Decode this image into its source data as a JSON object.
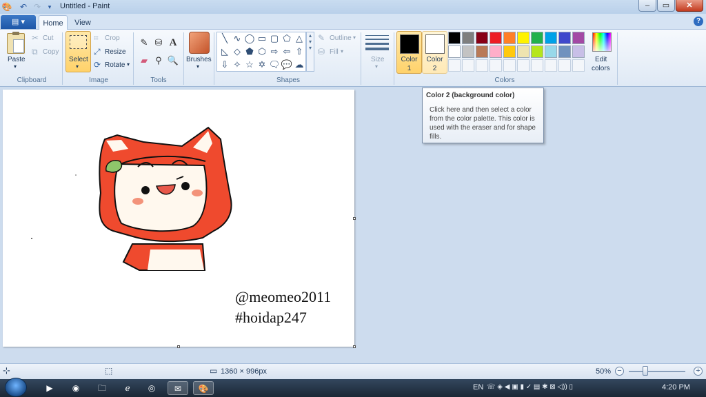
{
  "window": {
    "title": "Untitled - Paint",
    "minimize": "–",
    "maximize": "▭",
    "close": "✕"
  },
  "tabs": {
    "app_menu": "▤ ▾",
    "home": "Home",
    "view": "View",
    "help": "?"
  },
  "clipboard": {
    "paste": "Paste",
    "cut": "Cut",
    "copy": "Copy",
    "group": "Clipboard"
  },
  "image": {
    "select": "Select",
    "crop": "Crop",
    "resize": "Resize",
    "rotate": "Rotate",
    "group": "Image"
  },
  "tools": {
    "group": "Tools",
    "text_tool": "A"
  },
  "brushes": {
    "label": "Brushes"
  },
  "shapes": {
    "outline": "Outline",
    "fill": "Fill",
    "group": "Shapes"
  },
  "size": {
    "label": "Size"
  },
  "colors": {
    "color1_label": "Color",
    "color1_num": "1",
    "color2_label": "Color",
    "color2_num": "2",
    "color1": "#000000",
    "color2": "#ffffff",
    "edit_label": "Edit",
    "edit_label2": "colors",
    "group": "Colors",
    "palette_row1": [
      "#000000",
      "#7f7f7f",
      "#880015",
      "#ed1c24",
      "#ff7f27",
      "#fff200",
      "#22b14c",
      "#00a2e8",
      "#3f48cc",
      "#a349a4"
    ],
    "palette_row2": [
      "#ffffff",
      "#c3c3c3",
      "#b97a57",
      "#ffaec9",
      "#ffc90e",
      "#efe4b0",
      "#b5e61d",
      "#99d9ea",
      "#7092be",
      "#c8bfe7"
    ]
  },
  "tooltip": {
    "title": "Color 2 (background color)",
    "body": "Click here and then select a color from the color palette. This color is used with the eraser and for shape fills."
  },
  "canvas": {
    "watermark_line1": "@meomeo2011",
    "watermark_line2": "#hoidap247"
  },
  "status": {
    "dimensions": "1360 × 996px",
    "zoom": "50%"
  },
  "taskbar": {
    "lang": "EN",
    "time": "4:20 PM"
  }
}
